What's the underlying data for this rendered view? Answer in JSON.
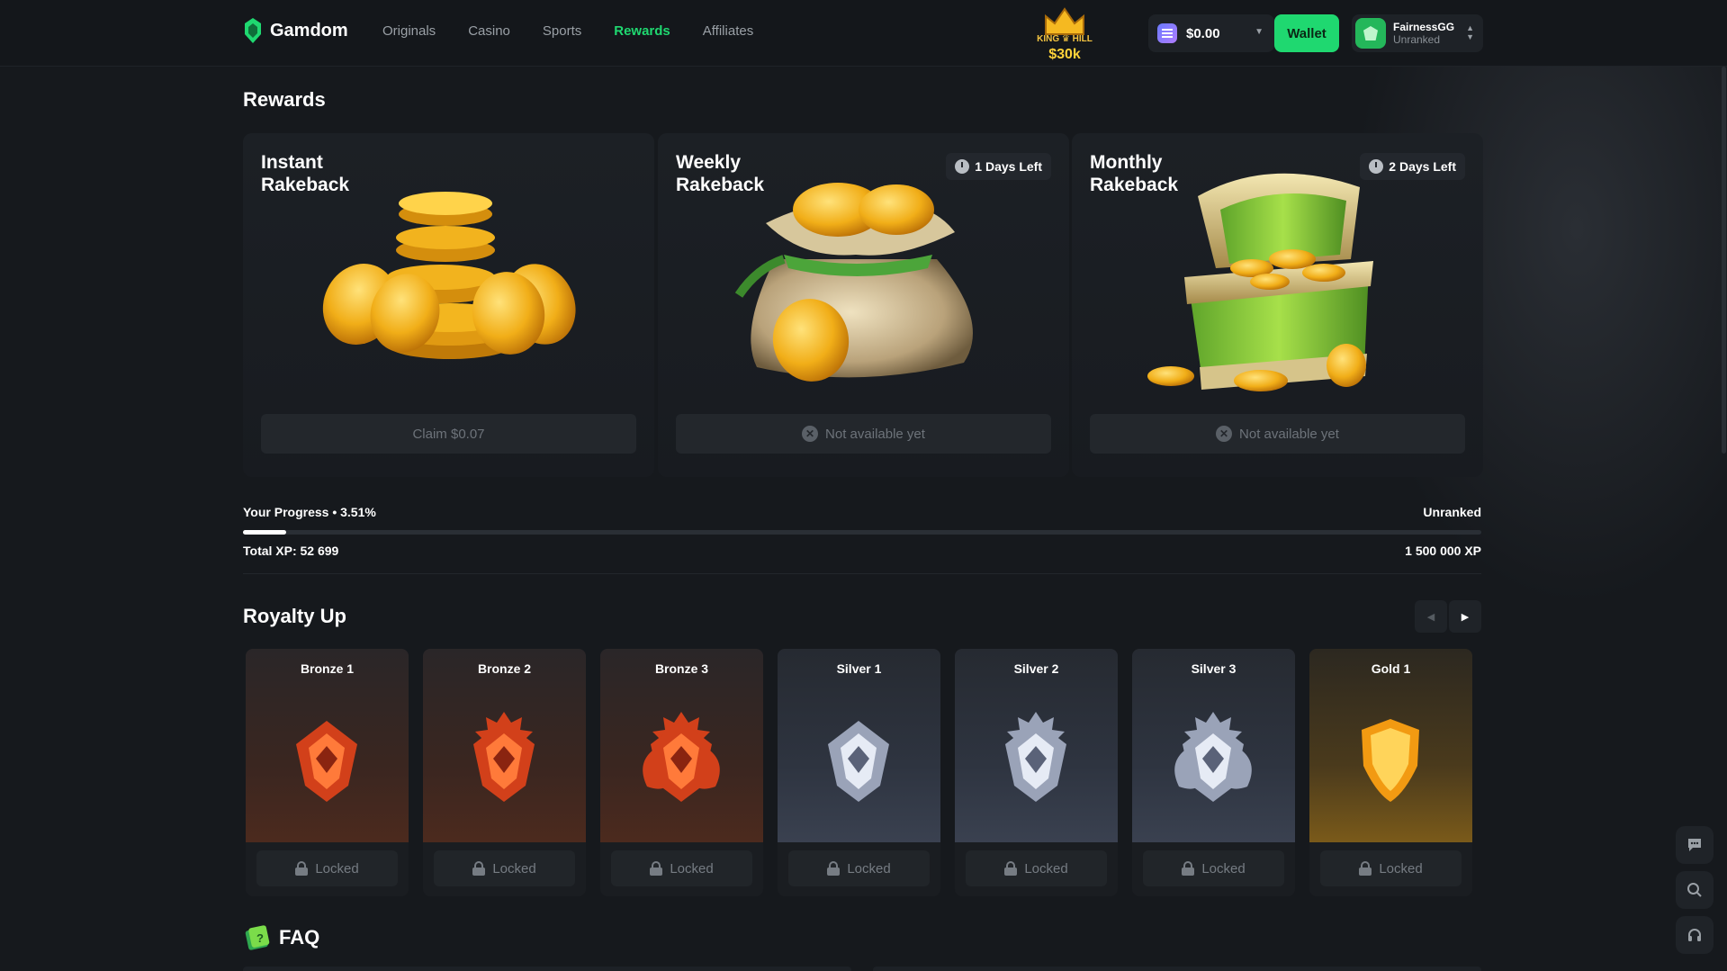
{
  "brand": {
    "name": "Gamdom",
    "accent": "#1fd870"
  },
  "nav": {
    "items": [
      "Originals",
      "Casino",
      "Sports",
      "Rewards",
      "Affiliates"
    ],
    "active": "Rewards"
  },
  "promo": {
    "line1": "KING",
    "line2": "HILL",
    "amount": "$30k"
  },
  "header": {
    "balance": "$0.00",
    "wallet_label": "Wallet",
    "username": "FairnessGG",
    "rank": "Unranked"
  },
  "page_title": "Rewards",
  "rewards": [
    {
      "title": "Instant Rakeback",
      "days_left": "",
      "button": "Claim  $0.07",
      "available": true,
      "icon": "coin-stack-icon"
    },
    {
      "title": "Weekly Rakeback",
      "days_left": "1 Days Left",
      "button": "Not available yet",
      "available": false,
      "icon": "coin-bag-icon"
    },
    {
      "title": "Monthly Rakeback",
      "days_left": "2 Days Left",
      "button": "Not available yet",
      "available": false,
      "icon": "treasure-chest-icon"
    }
  ],
  "progress": {
    "label": "Your Progress • 3.51%",
    "fraction": 0.0351,
    "rank": "Unranked",
    "total_xp": "Total XP: 52 699",
    "target_xp": "1 500 000 XP"
  },
  "royalty": {
    "title": "Royalty Up",
    "tiers": [
      {
        "name": "Bronze 1",
        "kind": "bronze",
        "status": "Locked"
      },
      {
        "name": "Bronze 2",
        "kind": "bronze",
        "status": "Locked"
      },
      {
        "name": "Bronze 3",
        "kind": "bronze",
        "status": "Locked"
      },
      {
        "name": "Silver 1",
        "kind": "silver",
        "status": "Locked"
      },
      {
        "name": "Silver 2",
        "kind": "silver",
        "status": "Locked"
      },
      {
        "name": "Silver 3",
        "kind": "silver",
        "status": "Locked"
      },
      {
        "name": "Gold 1",
        "kind": "gold",
        "status": "Locked"
      }
    ]
  },
  "faq": {
    "title": "FAQ"
  },
  "side_widgets": [
    "chat-icon",
    "search-icon",
    "headset-icon"
  ]
}
